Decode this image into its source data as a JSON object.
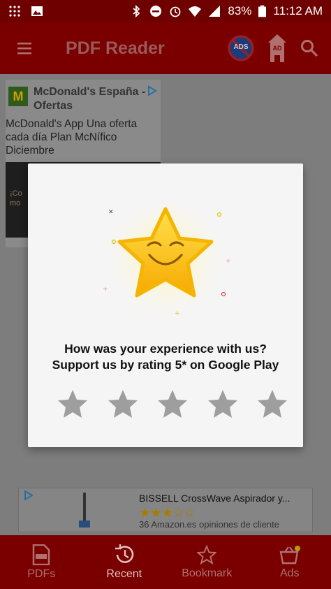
{
  "status_bar": {
    "battery": "83%",
    "time": "11:12 AM"
  },
  "app_bar": {
    "title": "PDF Reader",
    "ads_badge": "ADS",
    "ad_tower_label": "AD"
  },
  "background_ad": {
    "logo": "M",
    "title": "McDonald's España - Ofertas",
    "description": "McDonald's App Una oferta cada día Plan McNífico Diciembre",
    "image_text": "¡Co mo"
  },
  "bottom_ad": {
    "title": "BISSELL CrossWave Aspirador y...",
    "stars": "★★★☆☆",
    "reviews": "36 Amazon.es opiniones de cliente"
  },
  "dialog": {
    "line1": "How was your experience with us?",
    "line2": "Support us by rating 5* on Google Play"
  },
  "bottom_nav": [
    {
      "label": "PDFs",
      "icon": "pdf-file-icon"
    },
    {
      "label": "Recent",
      "icon": "history-icon"
    },
    {
      "label": "Bookmark",
      "icon": "star-outline-icon"
    },
    {
      "label": "Ads",
      "icon": "basket-icon"
    }
  ],
  "colors": {
    "app_bar": "#7a0000",
    "dialog_bg": "#f5f5f5",
    "rating_star": "#9e9e9e"
  }
}
